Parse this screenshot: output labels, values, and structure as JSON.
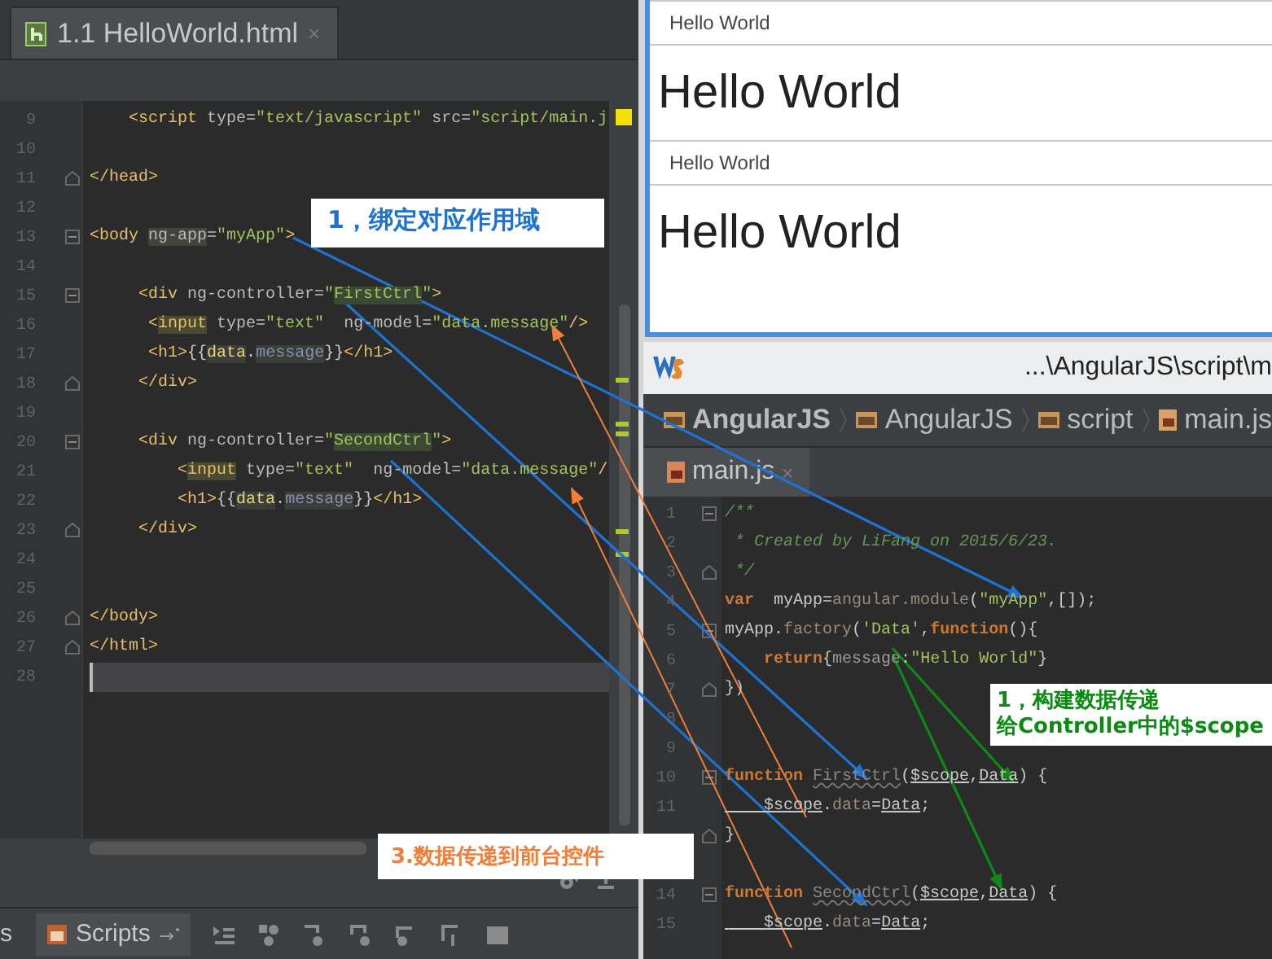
{
  "html_editor": {
    "tab": {
      "label": "1.1 HelloWorld.html",
      "close": "×"
    },
    "lines": [
      {
        "number": "9",
        "current": false,
        "fold_start": false,
        "fold_end": false,
        "tokens": [
          {
            "kind": "tag",
            "text": "    <script"
          },
          {
            "kind": "attr",
            "text": " type="
          },
          {
            "kind": "str",
            "text": "\"text/javascript\""
          },
          {
            "kind": "attr",
            "text": " src="
          },
          {
            "kind": "str",
            "text": "\"script/main.j"
          }
        ]
      },
      {
        "number": "10",
        "current": false,
        "fold_start": false,
        "fold_end": false
      },
      {
        "number": "11",
        "current": false,
        "fold_start": false,
        "fold_end": true,
        "tokens": [
          {
            "kind": "tag",
            "text": "</head>"
          }
        ]
      },
      {
        "number": "12",
        "current": false,
        "fold_start": false,
        "fold_end": false
      },
      {
        "number": "13",
        "current": false,
        "fold_start": true,
        "fold_end": false,
        "tokens": [
          {
            "kind": "tag",
            "text": "<body "
          },
          {
            "kind": "attr-hl",
            "text": "ng-app"
          },
          {
            "kind": "attr",
            "text": "="
          },
          {
            "kind": "str",
            "text": "\"myApp\""
          },
          {
            "kind": "tag",
            "text": ">"
          }
        ]
      },
      {
        "number": "14",
        "current": false,
        "fold_start": false,
        "fold_end": false
      },
      {
        "number": "15",
        "current": false,
        "fold_start": true,
        "fold_end": false,
        "tokens": [
          {
            "kind": "tag",
            "text": "     <div"
          },
          {
            "kind": "attr",
            "text": " ng-controller="
          },
          {
            "kind": "str",
            "text": "\""
          },
          {
            "kind": "str-hl",
            "text": "FirstCtrl"
          },
          {
            "kind": "str",
            "text": "\""
          },
          {
            "kind": "tag",
            "text": ">"
          }
        ]
      },
      {
        "number": "16",
        "current": false,
        "fold_start": false,
        "fold_end": false,
        "tokens": [
          {
            "kind": "tag",
            "text": "      <"
          },
          {
            "kind": "tag-hl",
            "text": "input"
          },
          {
            "kind": "attr",
            "text": " type="
          },
          {
            "kind": "str",
            "text": "\"text\""
          },
          {
            "kind": "attr",
            "text": "  ng-model="
          },
          {
            "kind": "str",
            "text": "\"data.message\""
          },
          {
            "kind": "tag",
            "text": "/>"
          }
        ]
      },
      {
        "number": "17",
        "current": false,
        "fold_start": false,
        "fold_end": false,
        "tokens": [
          {
            "kind": "tag",
            "text": "      <h1>"
          },
          {
            "kind": "plain",
            "text": "{{"
          },
          {
            "kind": "var-hl",
            "text": "data"
          },
          {
            "kind": "plain",
            "text": "."
          },
          {
            "kind": "member-hl",
            "text": "message"
          },
          {
            "kind": "plain",
            "text": "}}"
          },
          {
            "kind": "tag",
            "text": "</h1>"
          }
        ]
      },
      {
        "number": "18",
        "current": false,
        "fold_start": false,
        "fold_end": true,
        "tokens": [
          {
            "kind": "tag",
            "text": "     </div>"
          }
        ]
      },
      {
        "number": "19",
        "current": false,
        "fold_start": false,
        "fold_end": false
      },
      {
        "number": "20",
        "current": false,
        "fold_start": true,
        "fold_end": false,
        "tokens": [
          {
            "kind": "tag",
            "text": "     <div"
          },
          {
            "kind": "attr",
            "text": " ng-controller="
          },
          {
            "kind": "str",
            "text": "\""
          },
          {
            "kind": "str-hl",
            "text": "SecondCtrl"
          },
          {
            "kind": "str",
            "text": "\""
          },
          {
            "kind": "tag",
            "text": ">"
          }
        ]
      },
      {
        "number": "21",
        "current": false,
        "fold_start": false,
        "fold_end": false,
        "tokens": [
          {
            "kind": "tag",
            "text": "         <"
          },
          {
            "kind": "tag-hl",
            "text": "input"
          },
          {
            "kind": "attr",
            "text": " type="
          },
          {
            "kind": "str",
            "text": "\"text\""
          },
          {
            "kind": "attr",
            "text": "  ng-model="
          },
          {
            "kind": "str",
            "text": "\"data.message\""
          },
          {
            "kind": "tag",
            "text": "/"
          }
        ]
      },
      {
        "number": "22",
        "current": false,
        "fold_start": false,
        "fold_end": false,
        "tokens": [
          {
            "kind": "tag",
            "text": "         <h1>"
          },
          {
            "kind": "plain",
            "text": "{{"
          },
          {
            "kind": "var-hl",
            "text": "data"
          },
          {
            "kind": "plain",
            "text": "."
          },
          {
            "kind": "member-hl",
            "text": "message"
          },
          {
            "kind": "plain",
            "text": "}}"
          },
          {
            "kind": "tag",
            "text": "</h1>"
          }
        ]
      },
      {
        "number": "23",
        "current": false,
        "fold_start": false,
        "fold_end": true,
        "tokens": [
          {
            "kind": "tag",
            "text": "     </div>"
          }
        ]
      },
      {
        "number": "24",
        "current": false,
        "fold_start": false,
        "fold_end": false
      },
      {
        "number": "25",
        "current": false,
        "fold_start": false,
        "fold_end": false
      },
      {
        "number": "26",
        "current": false,
        "fold_start": false,
        "fold_end": true,
        "tokens": [
          {
            "kind": "tag",
            "text": "</body>"
          }
        ]
      },
      {
        "number": "27",
        "current": false,
        "fold_start": false,
        "fold_end": true,
        "tokens": [
          {
            "kind": "tag",
            "text": "</html>"
          }
        ]
      },
      {
        "number": "28",
        "current": true,
        "fold_start": false,
        "fold_end": false
      }
    ]
  },
  "bottom_tool_tabs": [
    {
      "label": "s",
      "selected": false
    },
    {
      "label": "Scripts",
      "selected": true
    }
  ],
  "browser": {
    "items": [
      {
        "kind": "field",
        "text": "Hello World"
      },
      {
        "kind": "heading",
        "text": "Hello World"
      },
      {
        "kind": "field",
        "text": "Hello World"
      },
      {
        "kind": "heading",
        "text": "Hello World"
      }
    ]
  },
  "webstorm": {
    "title": "...\\AngularJS\\script\\m",
    "breadcrumbs": [
      {
        "kind": "project",
        "label": "AngularJS"
      },
      {
        "kind": "folder",
        "label": "AngularJS"
      },
      {
        "kind": "folder",
        "label": "script"
      },
      {
        "kind": "file",
        "label": "main.js"
      }
    ],
    "tab": {
      "label": "main.js",
      "close": "×"
    },
    "lines": [
      {
        "number": "1",
        "fold_start": true,
        "fold_end": false,
        "tokens": [
          {
            "kind": "comment",
            "text": "/**"
          }
        ]
      },
      {
        "number": "2",
        "fold_start": false,
        "fold_end": false,
        "tokens": [
          {
            "kind": "comment",
            "text": " * Created by LiFang on 2015/6/23."
          }
        ]
      },
      {
        "number": "3",
        "fold_start": false,
        "fold_end": true,
        "tokens": [
          {
            "kind": "comment",
            "text": " */"
          }
        ]
      },
      {
        "number": "4",
        "fold_start": false,
        "fold_end": false,
        "tokens": [
          {
            "kind": "keyword",
            "text": "var"
          },
          {
            "kind": "plain",
            "text": "  myApp="
          },
          {
            "kind": "dim",
            "text": "angular.module"
          },
          {
            "kind": "plain",
            "text": "("
          },
          {
            "kind": "str",
            "text": "\"myApp\""
          },
          {
            "kind": "plain",
            "text": ",[]);"
          }
        ]
      },
      {
        "number": "5",
        "fold_start": true,
        "fold_end": false,
        "tokens": [
          {
            "kind": "plain",
            "text": "myApp."
          },
          {
            "kind": "dim",
            "text": "factory"
          },
          {
            "kind": "plain",
            "text": "("
          },
          {
            "kind": "str",
            "text": "'Data'"
          },
          {
            "kind": "plain",
            "text": ","
          },
          {
            "kind": "keyword",
            "text": "function"
          },
          {
            "kind": "plain",
            "text": "(){"
          }
        ]
      },
      {
        "number": "6",
        "fold_start": false,
        "fold_end": false,
        "tokens": [
          {
            "kind": "keyword",
            "text": "    return"
          },
          {
            "kind": "plain",
            "text": "{"
          },
          {
            "kind": "member",
            "text": "message"
          },
          {
            "kind": "plain",
            "text": ":"
          },
          {
            "kind": "str",
            "text": "\"Hello World\""
          },
          {
            "kind": "plain",
            "text": "}"
          }
        ]
      },
      {
        "number": "7",
        "fold_start": false,
        "fold_end": true,
        "tokens": [
          {
            "kind": "plain",
            "text": "})"
          }
        ]
      },
      {
        "number": "8",
        "fold_start": false,
        "fold_end": false
      },
      {
        "number": "9",
        "fold_start": false,
        "fold_end": false
      },
      {
        "number": "10",
        "fold_start": true,
        "fold_end": false,
        "tokens": [
          {
            "kind": "keyword",
            "text": "function "
          },
          {
            "kind": "unused",
            "text": "FirstCtrl"
          },
          {
            "kind": "plain",
            "text": "("
          },
          {
            "kind": "param",
            "text": "$scope"
          },
          {
            "kind": "plain",
            "text": ","
          },
          {
            "kind": "param",
            "text": "Data"
          },
          {
            "kind": "plain",
            "text": ") {"
          }
        ]
      },
      {
        "number": "11",
        "fold_start": false,
        "fold_end": false,
        "tokens": [
          {
            "kind": "param",
            "text": "    $scope"
          },
          {
            "kind": "plain",
            "text": "."
          },
          {
            "kind": "dim",
            "text": "data"
          },
          {
            "kind": "plain",
            "text": "="
          },
          {
            "kind": "param",
            "text": "Data"
          },
          {
            "kind": "plain",
            "text": ";"
          }
        ]
      },
      {
        "fold_start": false,
        "fold_end": true,
        "tokens": [
          {
            "kind": "plain",
            "text": "}"
          }
        ]
      },
      {
        "fold_start": false,
        "fold_end": false
      },
      {
        "number": "14",
        "fold_start": true,
        "fold_end": false,
        "tokens": [
          {
            "kind": "keyword",
            "text": "function "
          },
          {
            "kind": "unused",
            "text": "SecondCtrl"
          },
          {
            "kind": "plain",
            "text": "("
          },
          {
            "kind": "param",
            "text": "$scope"
          },
          {
            "kind": "plain",
            "text": ","
          },
          {
            "kind": "param",
            "text": "Data"
          },
          {
            "kind": "plain",
            "text": ") {"
          }
        ]
      },
      {
        "number": "15",
        "fold_start": false,
        "fold_end": false,
        "tokens": [
          {
            "kind": "param",
            "text": "    $scope"
          },
          {
            "kind": "plain",
            "text": "."
          },
          {
            "kind": "dim",
            "text": "data"
          },
          {
            "kind": "plain",
            "text": "="
          },
          {
            "kind": "param",
            "text": "Data"
          },
          {
            "kind": "plain",
            "text": ";"
          }
        ]
      }
    ]
  },
  "callouts": [
    {
      "kind": "blue",
      "lines": [
        "1，绑定对应作用域"
      ]
    },
    {
      "kind": "green",
      "lines": [
        "1，构建数据传递",
        "给Controller中的$scope"
      ]
    },
    {
      "kind": "orange",
      "lines": [
        "3.数据传递到前台控件"
      ]
    }
  ]
}
